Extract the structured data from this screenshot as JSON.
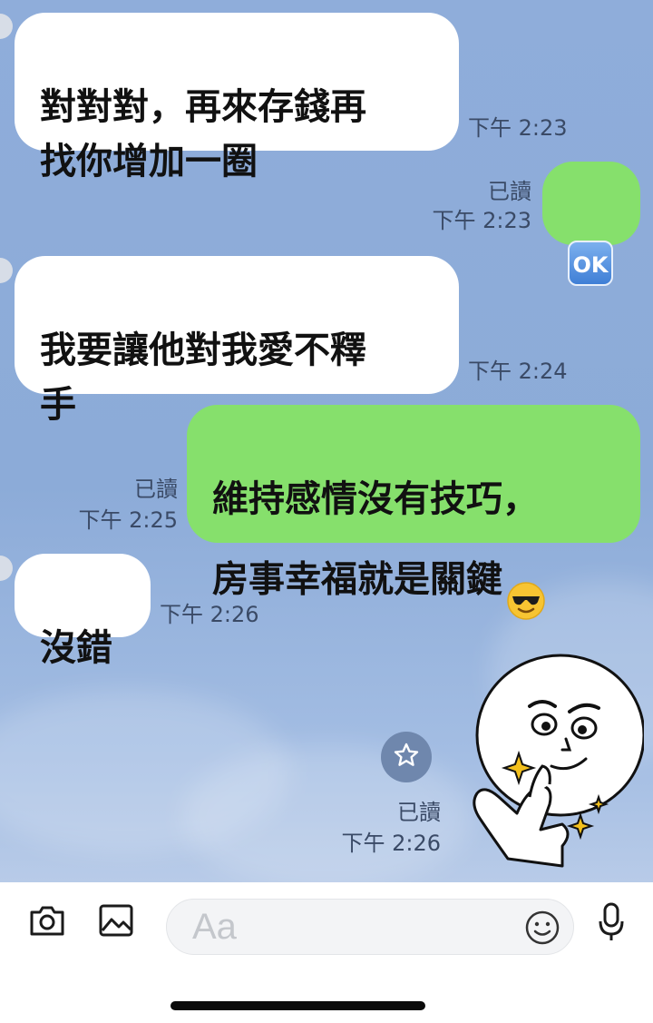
{
  "messages": [
    {
      "dir": "in",
      "text": "對對對，再來存錢再\n找你增加一圈",
      "time": "下午 2:23"
    },
    {
      "dir": "out",
      "read": "已讀",
      "time": "下午 2:23",
      "emoji": "OK"
    },
    {
      "dir": "in",
      "text": "我要讓他對我愛不釋\n手",
      "time": "下午 2:24"
    },
    {
      "dir": "out",
      "text": "維持感情沒有技巧，\n房事幸福就是關鍵",
      "read": "已讀",
      "time": "下午 2:25"
    },
    {
      "dir": "in",
      "text": "沒錯",
      "time": "下午 2:26"
    },
    {
      "dir": "out",
      "type": "sticker",
      "read": "已讀",
      "time": "下午 2:26"
    }
  ],
  "composer": {
    "placeholder": "Aa"
  },
  "icons": [
    "camera-icon",
    "image-icon",
    "emoji-icon",
    "microphone-icon",
    "star-icon",
    "sunglasses-emoji-icon"
  ],
  "colors": {
    "incoming": "#ffffff",
    "outgoing": "#86e06c",
    "chat_bg": "#8fadda"
  }
}
